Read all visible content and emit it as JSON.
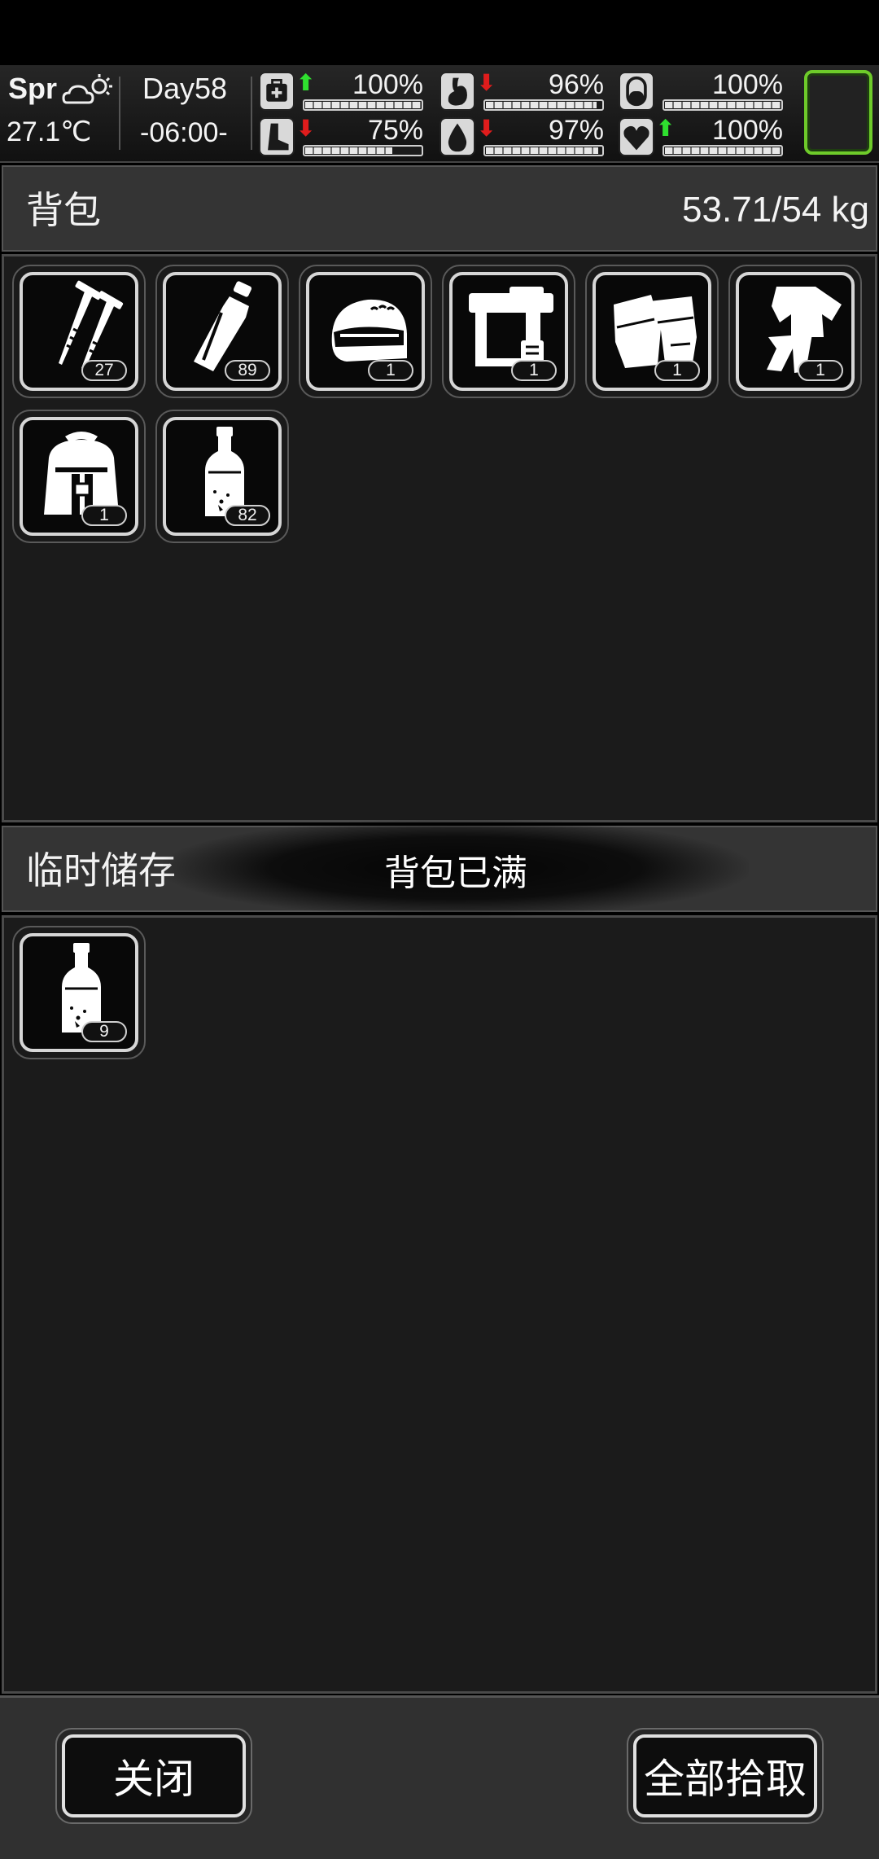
{
  "status": {
    "season": "Spr",
    "temperature": "27.1℃",
    "day": "Day58",
    "time": "-06:00-",
    "stats": [
      {
        "name": "health-icon",
        "trend": "up",
        "percent_label": "100%",
        "value": 1.0
      },
      {
        "name": "stomach-icon",
        "trend": "down",
        "percent_label": "96%",
        "value": 0.96
      },
      {
        "name": "pill-icon",
        "trend": "none",
        "percent_label": "100%",
        "value": 1.0
      },
      {
        "name": "foot-icon",
        "trend": "down",
        "percent_label": "75%",
        "value": 0.75
      },
      {
        "name": "water-drop-icon",
        "trend": "down",
        "percent_label": "97%",
        "value": 0.97
      },
      {
        "name": "heart-icon",
        "trend": "up",
        "percent_label": "100%",
        "value": 1.0
      }
    ],
    "colors": {
      "arrow_up": "#2fe02f",
      "arrow_down": "#e01c1c",
      "portrait_border": "#6ecb2a"
    }
  },
  "backpack": {
    "title": "背包",
    "weight": "53.71/54 kg",
    "items": [
      {
        "icon": "nails-icon",
        "count": "27"
      },
      {
        "icon": "plastic-bottle-icon",
        "count": "89"
      },
      {
        "icon": "helmet-icon",
        "count": "1"
      },
      {
        "icon": "nail-gun-icon",
        "count": "1"
      },
      {
        "icon": "gloves-icon",
        "count": "1"
      },
      {
        "icon": "clothes-icon",
        "count": "1"
      },
      {
        "icon": "backpack-icon",
        "count": "1"
      },
      {
        "icon": "glass-bottle-icon",
        "count": "82"
      }
    ]
  },
  "temp_storage": {
    "title": "临时储存",
    "items": [
      {
        "icon": "glass-bottle-icon",
        "count": "9"
      }
    ]
  },
  "toast": "背包已满",
  "buttons": {
    "close": "关闭",
    "pick_all": "全部拾取"
  }
}
